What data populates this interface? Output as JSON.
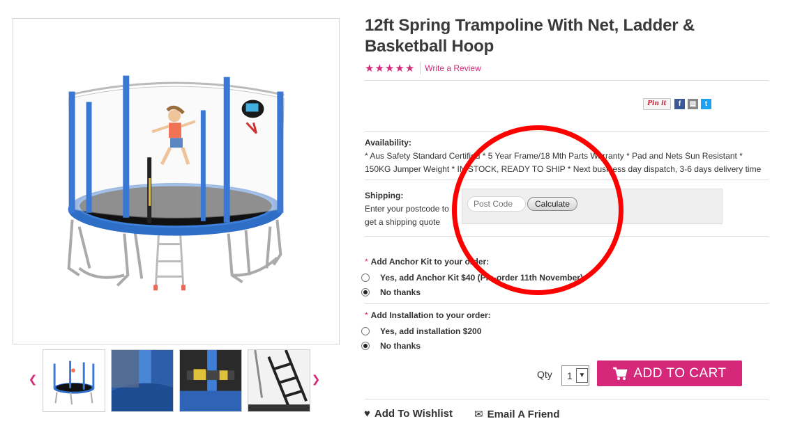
{
  "product": {
    "title": "12ft Spring Trampoline With Net, Ladder & Basketball Hoop",
    "rating_stars": 5,
    "review_link": "Write a Review"
  },
  "share": {
    "pin_label": "Pin it",
    "facebook_glyph": "f",
    "print_glyph": "▤",
    "twitter_glyph": "t"
  },
  "availability": {
    "label": "Availability:",
    "line1": "* Aus Safety Standard Certified * 5 Year Frame/18 Mth Parts Warranty * Pad and Nets Sun Resistant *",
    "line2": "150KG Jumper Weight * IN STOCK, READY TO SHIP * Next business day dispatch, 3-6 days delivery time"
  },
  "shipping": {
    "label": "Shipping:",
    "line1": "Enter your postcode to",
    "line2": "get a shipping quote",
    "postcode_placeholder": "Post Code",
    "calculate_label": "Calculate"
  },
  "options": [
    {
      "heading": "Add Anchor Kit to your order:",
      "choices": [
        {
          "label": "Yes, add Anchor Kit $40 (Pre-order 11th November)",
          "checked": false
        },
        {
          "label": "No thanks",
          "checked": true
        }
      ]
    },
    {
      "heading": "Add Installation to your order:",
      "choices": [
        {
          "label": "Yes, add installation $200",
          "checked": false
        },
        {
          "label": "No thanks",
          "checked": true
        }
      ]
    }
  ],
  "required_marker": "*",
  "cart": {
    "qty_label": "Qty",
    "qty_value": "1",
    "add_label": "ADD TO CART"
  },
  "actions": {
    "wishlist": "Add To Wishlist",
    "email": "Email A Friend"
  },
  "colors": {
    "accent": "#d6287a",
    "annotation": "#ff0000",
    "trampoline_blue": "#2f6ec6"
  }
}
